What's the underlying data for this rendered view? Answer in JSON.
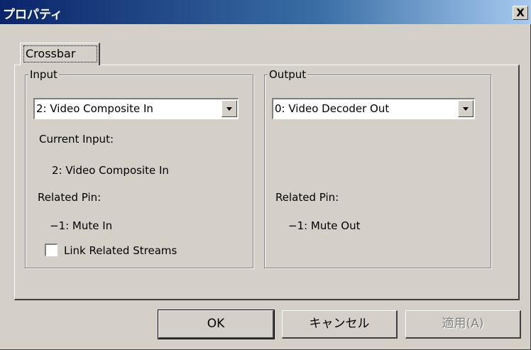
{
  "window": {
    "title": "プロパティ",
    "close_label": "X"
  },
  "tabs": [
    {
      "label": "Crossbar"
    }
  ],
  "input": {
    "group_label": "Input",
    "selected": "2: Video Composite In",
    "current_input_label": "Current Input:",
    "current_input_value": "2: Video Composite In",
    "related_pin_label": "Related Pin:",
    "related_pin_value": "−1: Mute In",
    "link_checkbox_label": "Link Related Streams",
    "link_checked": false
  },
  "output": {
    "group_label": "Output",
    "selected": "0: Video Decoder Out",
    "related_pin_label": "Related Pin:",
    "related_pin_value": "−1: Mute Out"
  },
  "buttons": {
    "ok": "OK",
    "cancel": "キャンセル",
    "apply": "適用(A)"
  },
  "icons": {
    "close": "close-icon",
    "dropdown": "chevron-down-icon"
  }
}
